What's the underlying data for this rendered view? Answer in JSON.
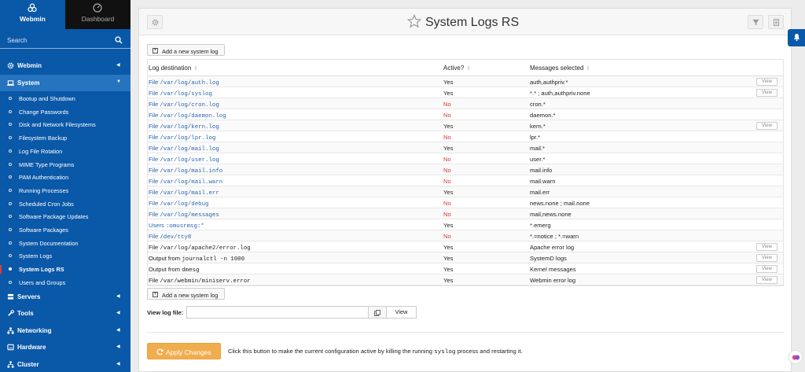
{
  "sidebar": {
    "brand": "Webmin",
    "dashboard": "Dashboard",
    "search_placeholder": "Search",
    "categories": [
      {
        "label": "Webmin"
      },
      {
        "label": "System"
      },
      {
        "label": "Servers"
      },
      {
        "label": "Tools"
      },
      {
        "label": "Networking"
      },
      {
        "label": "Hardware"
      },
      {
        "label": "Cluster"
      }
    ],
    "system_items": [
      "Bootup and Shutdown",
      "Change Passwords",
      "Disk and Network Filesystems",
      "Filesystem Backup",
      "Log File Rotation",
      "MIME Type Programs",
      "PAM Authentication",
      "Running Processes",
      "Scheduled Cron Jobs",
      "Software Package Updates",
      "Software Packages",
      "System Documentation",
      "System Logs",
      "System Logs RS",
      "Users and Groups"
    ]
  },
  "page": {
    "title": "System Logs RS",
    "add_label": "Add a new system log",
    "columns": [
      "Log destination",
      "Active?",
      "Messages selected"
    ],
    "rows": [
      {
        "prefix": "File",
        "path": "/var/log/auth.log",
        "active": "Yes",
        "messages": "auth,authpriv.*",
        "view": "View"
      },
      {
        "prefix": "File",
        "path": "/var/log/syslog",
        "active": "Yes",
        "messages": "*.* ; auth,authpriv.none",
        "view": "View"
      },
      {
        "prefix": "File",
        "path": "/var/log/cron.log",
        "active": "No",
        "messages": "cron.*",
        "view": ""
      },
      {
        "prefix": "File",
        "path": "/var/log/daemon.log",
        "active": "No",
        "messages": "daemon.*",
        "view": ""
      },
      {
        "prefix": "File",
        "path": "/var/log/kern.log",
        "active": "Yes",
        "messages": "kern.*",
        "view": "View"
      },
      {
        "prefix": "File",
        "path": "/var/log/lpr.log",
        "active": "No",
        "messages": "lpr.*",
        "view": ""
      },
      {
        "prefix": "File",
        "path": "/var/log/mail.log",
        "active": "Yes",
        "messages": "mail.*",
        "view": ""
      },
      {
        "prefix": "File",
        "path": "/var/log/user.log",
        "active": "No",
        "messages": "user.*",
        "view": ""
      },
      {
        "prefix": "File",
        "path": "/var/log/mail.info",
        "active": "No",
        "messages": "mail.info",
        "view": ""
      },
      {
        "prefix": "File",
        "path": "/var/log/mail.warn",
        "active": "No",
        "messages": "mail.warn",
        "view": ""
      },
      {
        "prefix": "File",
        "path": "/var/log/mail.err",
        "active": "Yes",
        "messages": "mail.err",
        "view": ""
      },
      {
        "prefix": "File",
        "path": "/var/log/debug",
        "active": "No",
        "messages": "news.none ; mail.none",
        "view": ""
      },
      {
        "prefix": "File",
        "path": "/var/log/messages",
        "active": "No",
        "messages": "mail,news.none",
        "view": ""
      },
      {
        "prefix": "Users",
        "path": ":omusrmsg:*",
        "active": "Yes",
        "messages": "*.emerg",
        "view": ""
      },
      {
        "prefix": "File",
        "path": "/dev/tty8",
        "active": "No",
        "messages": "*.=notice ; *.=warn",
        "view": ""
      },
      {
        "prefix": "File",
        "path": "/var/log/apache2/error.log",
        "active": "Yes",
        "messages": "Apache error log",
        "view": "View",
        "plain": true
      },
      {
        "prefix": "Output from",
        "path": "journalctl -n 1000",
        "active": "Yes",
        "messages": "SystemD logs",
        "view": "View",
        "plain": true
      },
      {
        "prefix": "Output from",
        "path": "dmesg",
        "active": "Yes",
        "messages": "Kernel messages",
        "view": "View",
        "plain": true
      },
      {
        "prefix": "File",
        "path": "/var/webmin/miniserv.error",
        "active": "Yes",
        "messages": "Webmin error log",
        "view": "View",
        "plain": true
      }
    ],
    "view_log_file_label": "View log file:",
    "view_log_file_value": "",
    "view_button": "View",
    "apply_label": "Apply Changes",
    "apply_hint_before": "Click this button to make the current configuration active by killing the running",
    "apply_hint_cmd": "syslog",
    "apply_hint_after": "process and restarting it."
  },
  "colors": {
    "sidebar": "#0a58a8",
    "accent_no": "#dd3333",
    "link": "#2a63b0",
    "apply": "#f0ad4e"
  }
}
